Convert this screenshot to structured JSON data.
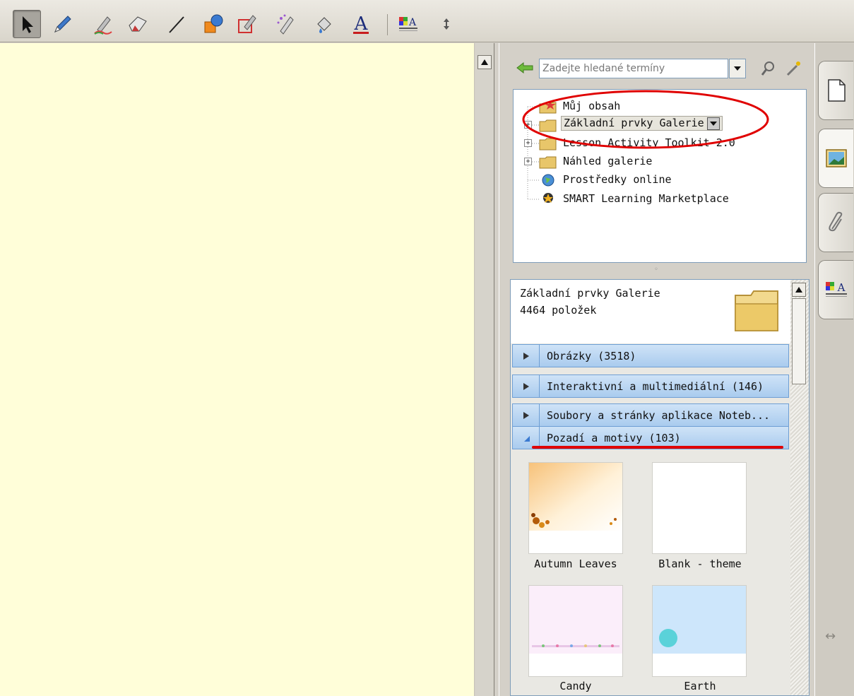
{
  "toolbar": {
    "tools": [
      {
        "name": "select-tool",
        "icon": "arrow-cursor-icon"
      },
      {
        "name": "pen-tool",
        "icon": "blue-pen-icon"
      },
      {
        "name": "creative-pen-tool",
        "icon": "creative-pen-icon"
      },
      {
        "name": "eraser-tool",
        "icon": "eraser-icon"
      },
      {
        "name": "line-tool",
        "icon": "line-icon"
      },
      {
        "name": "shapes-tool",
        "icon": "shapes-icon"
      },
      {
        "name": "shape-recognition-pen-tool",
        "icon": "shape-pen-icon"
      },
      {
        "name": "magic-pen-tool",
        "icon": "magic-pen-icon"
      },
      {
        "name": "fill-tool",
        "icon": "paint-bucket-icon"
      },
      {
        "name": "text-tool",
        "icon": "text-a-icon"
      },
      {
        "name": "properties-tool",
        "icon": "properties-icon"
      },
      {
        "name": "move-toolbar",
        "icon": "up-down-arrow-icon"
      }
    ],
    "text_tool_glyph": "A"
  },
  "search": {
    "placeholder": "Zadejte hledané termíny"
  },
  "tree": {
    "items": [
      {
        "label": "Můj obsah",
        "icon": "my-content-folder-icon",
        "expandable": false
      },
      {
        "label": "Základní prvky Galerie",
        "icon": "folder-icon",
        "expandable": true,
        "selected": true
      },
      {
        "label": "Lesson Activity Toolkit 2.0",
        "icon": "folder-icon",
        "expandable": true
      },
      {
        "label": "Náhled galerie",
        "icon": "folder-icon",
        "expandable": true
      },
      {
        "label": "Prostředky online",
        "icon": "globe-icon",
        "expandable": false
      },
      {
        "label": "SMART Learning Marketplace",
        "icon": "marketplace-icon",
        "expandable": false
      }
    ]
  },
  "gallery": {
    "title": "Základní prvky Galerie",
    "count": "4464 položek",
    "categories": [
      {
        "label": "Obrázky (3518)",
        "expanded": false
      },
      {
        "label": "Interaktivní a multimediální (146)",
        "expanded": false
      },
      {
        "label": "Soubory a stránky aplikace Noteb...",
        "expanded": false
      },
      {
        "label": "Pozadí a motivy (103)",
        "expanded": true
      }
    ],
    "thumbnails": [
      {
        "label": "Autumn Leaves"
      },
      {
        "label": "Blank - theme"
      },
      {
        "label": "Candy"
      },
      {
        "label": "Earth"
      }
    ]
  },
  "sidetabs": [
    {
      "name": "page-sorter-tab",
      "icon": "page-icon"
    },
    {
      "name": "gallery-tab",
      "icon": "gallery-picture-icon",
      "active": true
    },
    {
      "name": "attachments-tab",
      "icon": "paperclip-icon"
    },
    {
      "name": "properties-tab",
      "icon": "properties-icon"
    }
  ],
  "colors": {
    "canvas": "#fffed9",
    "annotation": "#e00000",
    "category_bar": "#a9cbee"
  }
}
